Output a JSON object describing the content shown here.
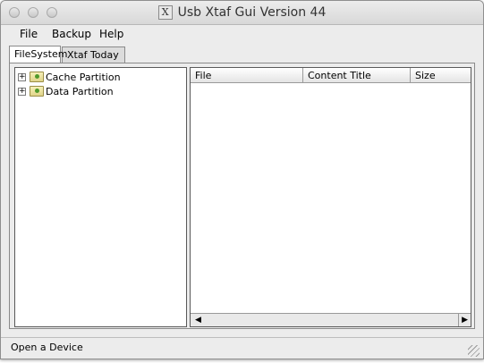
{
  "window": {
    "title": "Usb Xtaf Gui Version 44",
    "title_icon_glyph": "X"
  },
  "menubar": {
    "items": [
      "File",
      "Backup",
      "Help"
    ]
  },
  "tabs": [
    {
      "label": "FileSystem",
      "active": true
    },
    {
      "label": "Xtaf Today",
      "active": false
    }
  ],
  "tree": {
    "nodes": [
      {
        "label": "Cache Partition",
        "expander": "+"
      },
      {
        "label": "Data Partition",
        "expander": "+"
      }
    ]
  },
  "table": {
    "columns": [
      "File",
      "Content Title",
      "Size"
    ]
  },
  "scrollbar": {
    "left_arrow": "◀",
    "right_arrow": "▶"
  },
  "status": {
    "text": "Open a Device"
  }
}
